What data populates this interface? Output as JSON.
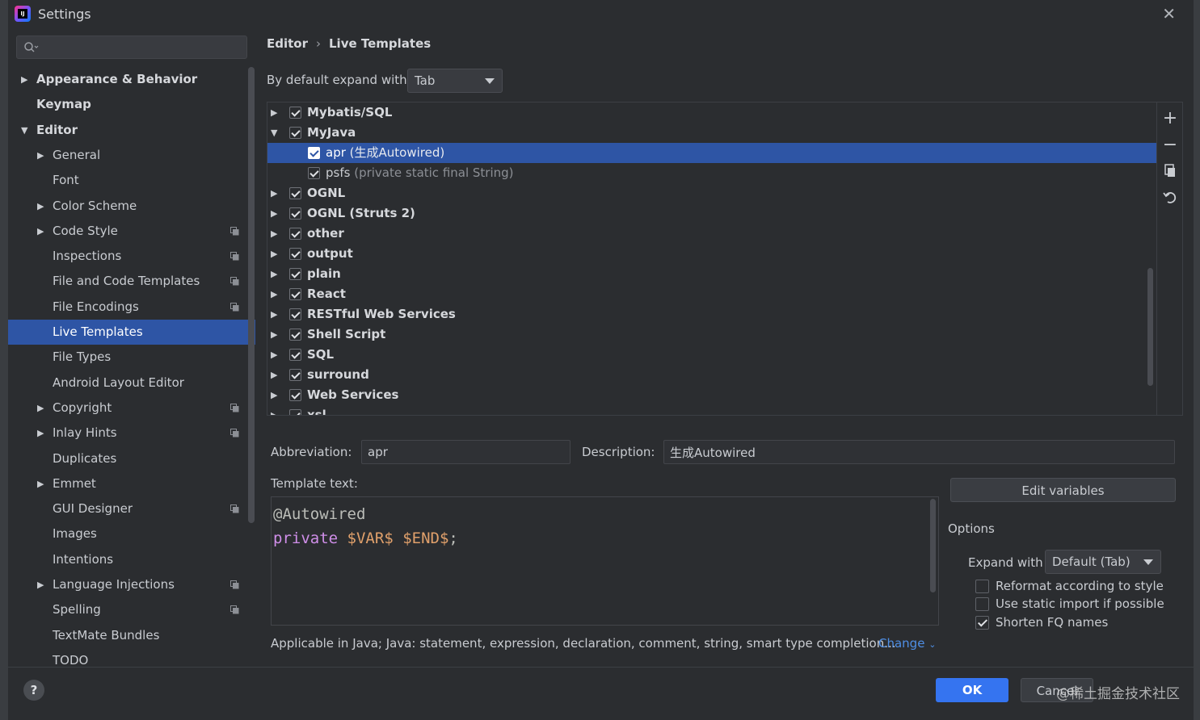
{
  "window": {
    "title": "Settings"
  },
  "search": {
    "placeholder": ""
  },
  "sidebar": {
    "items": [
      {
        "label": "Appearance & Behavior",
        "level": 0,
        "arrow": "▶"
      },
      {
        "label": "Keymap",
        "level": 0,
        "arrow": ""
      },
      {
        "label": "Editor",
        "level": 0,
        "arrow": "▼"
      },
      {
        "label": "General",
        "level": 1,
        "arrow": "▶"
      },
      {
        "label": "Font",
        "level": 1,
        "arrow": ""
      },
      {
        "label": "Color Scheme",
        "level": 1,
        "arrow": "▶"
      },
      {
        "label": "Code Style",
        "level": 1,
        "arrow": "▶",
        "project": true
      },
      {
        "label": "Inspections",
        "level": 1,
        "arrow": "",
        "project": true
      },
      {
        "label": "File and Code Templates",
        "level": 1,
        "arrow": "",
        "project": true
      },
      {
        "label": "File Encodings",
        "level": 1,
        "arrow": "",
        "project": true
      },
      {
        "label": "Live Templates",
        "level": 1,
        "arrow": "",
        "selected": true
      },
      {
        "label": "File Types",
        "level": 1,
        "arrow": ""
      },
      {
        "label": "Android Layout Editor",
        "level": 1,
        "arrow": ""
      },
      {
        "label": "Copyright",
        "level": 1,
        "arrow": "▶",
        "project": true
      },
      {
        "label": "Inlay Hints",
        "level": 1,
        "arrow": "▶",
        "project": true
      },
      {
        "label": "Duplicates",
        "level": 1,
        "arrow": ""
      },
      {
        "label": "Emmet",
        "level": 1,
        "arrow": "▶"
      },
      {
        "label": "GUI Designer",
        "level": 1,
        "arrow": "",
        "project": true
      },
      {
        "label": "Images",
        "level": 1,
        "arrow": ""
      },
      {
        "label": "Intentions",
        "level": 1,
        "arrow": ""
      },
      {
        "label": "Language Injections",
        "level": 1,
        "arrow": "▶",
        "project": true
      },
      {
        "label": "Spelling",
        "level": 1,
        "arrow": "",
        "project": true
      },
      {
        "label": "TextMate Bundles",
        "level": 1,
        "arrow": ""
      },
      {
        "label": "TODO",
        "level": 1,
        "arrow": ""
      }
    ]
  },
  "breadcrumb": {
    "parent": "Editor",
    "separator": "›",
    "current": "Live Templates"
  },
  "expand": {
    "label": "By default expand with",
    "value": "Tab"
  },
  "templates": [
    {
      "type": "group",
      "name": "Mybatis/SQL",
      "arrow": "▶"
    },
    {
      "type": "group",
      "name": "MyJava",
      "arrow": "▼"
    },
    {
      "type": "item",
      "name": "apr",
      "desc": "(生成Autowired)",
      "selected": true
    },
    {
      "type": "item",
      "name": "psfs",
      "desc": "(private static final String)"
    },
    {
      "type": "group",
      "name": "OGNL",
      "arrow": "▶"
    },
    {
      "type": "group",
      "name": "OGNL (Struts 2)",
      "arrow": "▶"
    },
    {
      "type": "group",
      "name": "other",
      "arrow": "▶"
    },
    {
      "type": "group",
      "name": "output",
      "arrow": "▶"
    },
    {
      "type": "group",
      "name": "plain",
      "arrow": "▶"
    },
    {
      "type": "group",
      "name": "React",
      "arrow": "▶"
    },
    {
      "type": "group",
      "name": "RESTful Web Services",
      "arrow": "▶"
    },
    {
      "type": "group",
      "name": "Shell Script",
      "arrow": "▶"
    },
    {
      "type": "group",
      "name": "SQL",
      "arrow": "▶"
    },
    {
      "type": "group",
      "name": "surround",
      "arrow": "▶"
    },
    {
      "type": "group",
      "name": "Web Services",
      "arrow": "▶"
    },
    {
      "type": "group",
      "name": "xsl",
      "arrow": "▶"
    }
  ],
  "tools": {
    "add": "+",
    "remove": "−",
    "copy": "copy-icon",
    "restore": "restore-icon"
  },
  "abbreviation": {
    "label": "Abbreviation:",
    "value": "apr"
  },
  "description": {
    "label": "Description:",
    "value": "生成Autowired"
  },
  "template_text": {
    "label": "Template text:",
    "line1": "@Autowired",
    "line2_kw": "private",
    "line2_var1": "$VAR$",
    "line2_var2": "$END$",
    "line2_end": ";"
  },
  "edit_variables": "Edit variables",
  "options": {
    "title": "Options",
    "expand_label": "Expand with",
    "expand_value": "Default (Tab)",
    "checks": [
      {
        "label": "Reformat according to style",
        "checked": false
      },
      {
        "label": "Use static import if possible",
        "checked": false
      },
      {
        "label": "Shorten FQ names",
        "checked": true
      }
    ]
  },
  "applicable": {
    "text": "Applicable in Java; Java: statement, expression, declaration, comment, string, smart type completion...",
    "change": "Change"
  },
  "footer": {
    "help": "?",
    "ok": "OK",
    "cancel": "Cancel",
    "watermark": "@稀土掘金技术社区"
  },
  "colors": {
    "selection": "#2e55a5",
    "ok_button": "#3574f0",
    "link": "#4f8fe6",
    "keyword": "#cf8ee8",
    "variable": "#e0a06b"
  }
}
